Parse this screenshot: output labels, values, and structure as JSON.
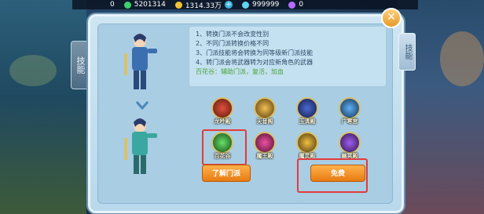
{
  "topbar": {
    "stat1": "0",
    "stat2": "5201314",
    "stat3": "1314.33万",
    "stat4": "999999",
    "stat5": "0"
  },
  "panel": {
    "info_lines": [
      "1、转换门派不会改变性别",
      "2、不同门派转换价格不同",
      "3、门派技能将会转换为同等级新门派技能",
      "4、转门派会将武器转为对应新角色的武器"
    ],
    "highlight_line": "百花谷：辅助门派，复活，加血",
    "sects": [
      {
        "name": "龙吟殿",
        "color": "#c23a2a"
      },
      {
        "name": "天音阁",
        "color": "#d8a13a"
      },
      {
        "name": "玉清殿",
        "color": "#2d3f8a"
      },
      {
        "name": "广寒宫",
        "color": "#3c7fc2"
      },
      {
        "name": "百花谷",
        "color": "#3aa83a"
      },
      {
        "name": "魔王殿",
        "color": "#c2307a"
      },
      {
        "name": "魔灵殿",
        "color": "#c49a2a"
      },
      {
        "name": "幽冥殿",
        "color": "#7a3aa8"
      }
    ],
    "learn_button": "了解门派",
    "free_button": "免费",
    "skill_tab": "技能",
    "close_label": "✕"
  },
  "side": {
    "left_tab": "技能"
  },
  "colors": {
    "selection_highlight": "#e23b3b",
    "button_orange": "#e77b12"
  }
}
